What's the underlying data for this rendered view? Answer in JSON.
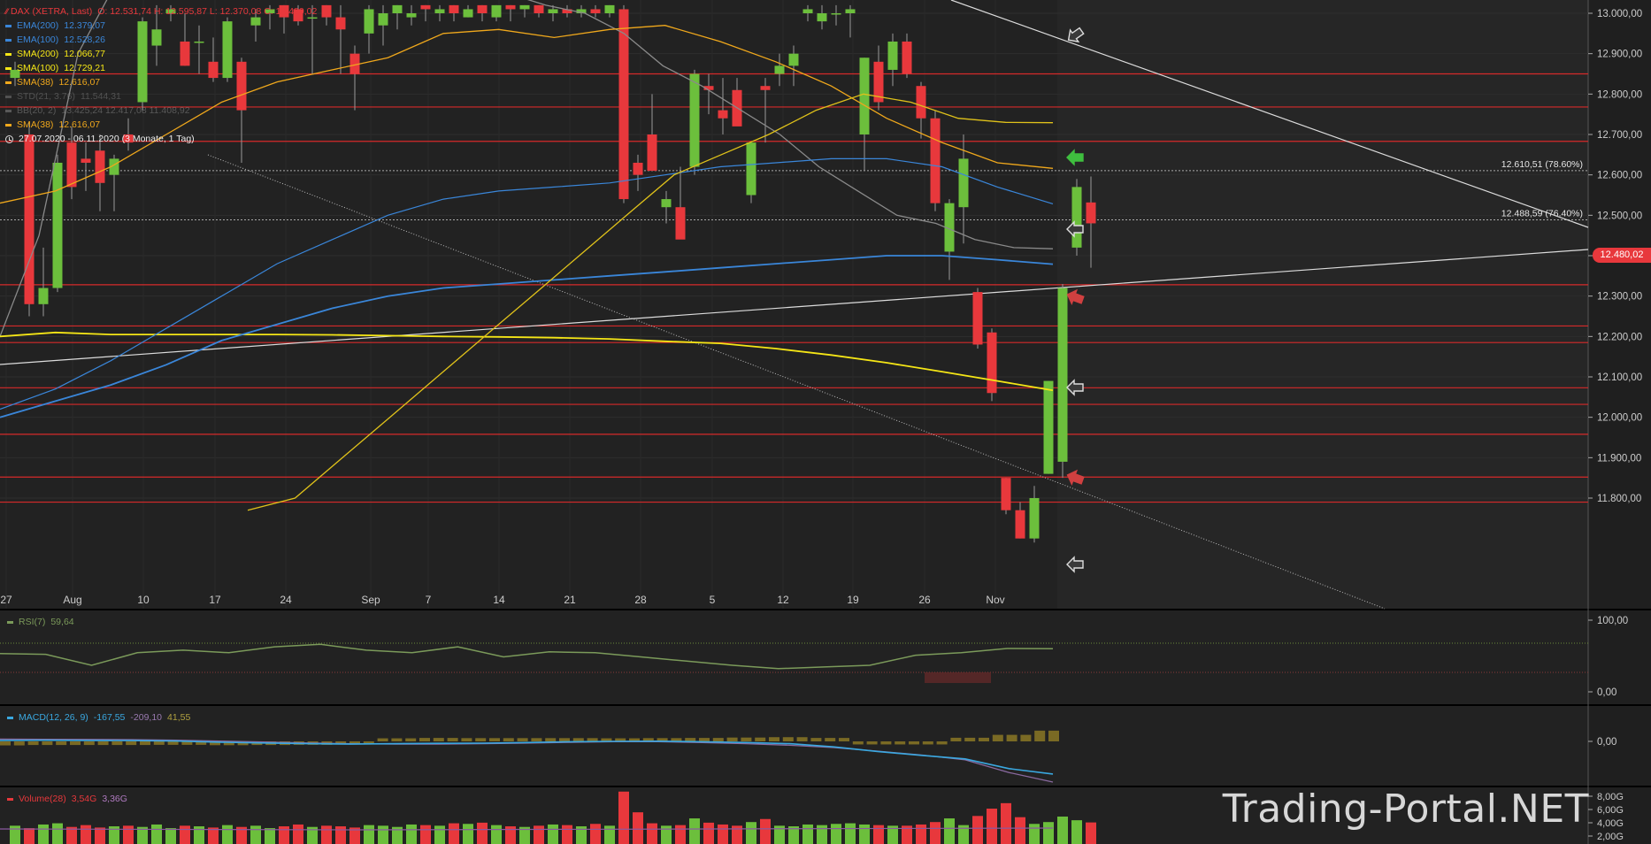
{
  "header": {
    "instrument": "DAX (XETRA, Last)",
    "ohlc": "O: 12.531,74  H: 12.595,87  L: 12.370,08  C: 12.480,02",
    "range": "27.07.2020 - 06.11.2020   (3 Monate, 1 Tag)"
  },
  "indicators": [
    {
      "name": "EMA(200)",
      "value": "12.379,07",
      "color": "#3a86d9",
      "dim": false
    },
    {
      "name": "EMA(100)",
      "value": "12.528,26",
      "color": "#3a86d9",
      "dim": false
    },
    {
      "name": "SMA(200)",
      "value": "12.066,77",
      "color": "#f5e616",
      "dim": false
    },
    {
      "name": "SMA(100)",
      "value": "12.729,21",
      "color": "#f5e616",
      "dim": false
    },
    {
      "name": "SMA(38)",
      "value": "12.616,07",
      "color": "#f0a81c",
      "dim": false
    },
    {
      "name": "STD(21, 3.76)",
      "value": "11.544,31",
      "color": "#888888",
      "dim": true
    },
    {
      "name": "BB(20, 2)",
      "value": "13.425,24  12.417,08  11.408,92",
      "color": "#9a9a9a",
      "dim": true
    },
    {
      "name": "SMA(38)",
      "value": "12.616,07",
      "color": "#f0a81c",
      "dim": false
    }
  ],
  "price_axis": [
    "13.000,00",
    "12.900,00",
    "12.800,00",
    "12.700,00",
    "12.600,00",
    "12.500,00",
    "12.400,00",
    "12.300,00",
    "12.200,00",
    "12.100,00",
    "12.000,00",
    "11.900,00",
    "11.800,00"
  ],
  "date_axis": [
    "27",
    "Aug",
    "10",
    "17",
    "24",
    "Sep",
    "7",
    "14",
    "21",
    "28",
    "5",
    "12",
    "19",
    "26",
    "Nov"
  ],
  "fib_levels": [
    {
      "value": 12610.51,
      "label": "12.610,51 (78.60%)"
    },
    {
      "value": 12488.59,
      "label": "12.488,59 (76.40%)"
    }
  ],
  "last_price": "12.480,02",
  "colors": {
    "up": "#6cbf3c",
    "down": "#e8383c",
    "ema": "#3a86d9",
    "sma_fast": "#f0a81c",
    "sma_mid": "#e0c21a",
    "sma_slow": "#f5e616",
    "bb": "#8a8a8a",
    "hline": "#d62a2a",
    "rsi": "#7b9a5a",
    "macd": "#3aa8e0",
    "signal": "#8a6aa0"
  },
  "rsi": {
    "label": "RSI(7)",
    "value": "59,64",
    "axis": [
      "100,00",
      "0,00"
    ]
  },
  "macd": {
    "label": "MACD(12, 26, 9)",
    "v1": "-167,55",
    "v2": "-209,10",
    "v3": "41,55",
    "axis": [
      "0,00"
    ]
  },
  "volume": {
    "label": "Volume(28)",
    "v1": "3,54G",
    "v2": "3,36G",
    "axis": [
      "8,00G",
      "6,00G",
      "4,00G",
      "2,00G"
    ]
  },
  "watermark": "Trading-Portal.NET",
  "chart_data": {
    "type": "candlestick",
    "ylim": [
      11770,
      13020
    ],
    "candles": [
      {
        "o": 12840,
        "h": 12880,
        "l": 12820,
        "c": 12860
      },
      {
        "o": 12700,
        "h": 12730,
        "l": 12250,
        "c": 12280
      },
      {
        "o": 12280,
        "h": 12420,
        "l": 12250,
        "c": 12320
      },
      {
        "o": 12320,
        "h": 12650,
        "l": 12310,
        "c": 12630
      },
      {
        "o": 12680,
        "h": 12720,
        "l": 12540,
        "c": 12570
      },
      {
        "o": 12640,
        "h": 12680,
        "l": 12560,
        "c": 12630
      },
      {
        "o": 12660,
        "h": 12700,
        "l": 12510,
        "c": 12580
      },
      {
        "o": 12600,
        "h": 12650,
        "l": 12510,
        "c": 12640
      },
      {
        "o": 12700,
        "h": 12740,
        "l": 12660,
        "c": 12680
      },
      {
        "o": 12780,
        "h": 12990,
        "l": 12760,
        "c": 12980
      },
      {
        "o": 12920,
        "h": 13020,
        "l": 12870,
        "c": 12960
      },
      {
        "o": 13000,
        "h": 13020,
        "l": 12980,
        "c": 13010
      },
      {
        "o": 12930,
        "h": 13000,
        "l": 12870,
        "c": 12870
      },
      {
        "o": 12930,
        "h": 12970,
        "l": 12850,
        "c": 12930
      },
      {
        "o": 12880,
        "h": 12940,
        "l": 12830,
        "c": 12840
      },
      {
        "o": 12840,
        "h": 12990,
        "l": 12830,
        "c": 12980
      },
      {
        "o": 12880,
        "h": 12890,
        "l": 12630,
        "c": 12760
      },
      {
        "o": 12970,
        "h": 13010,
        "l": 12930,
        "c": 12990
      },
      {
        "o": 13000,
        "h": 13020,
        "l": 12960,
        "c": 13010
      },
      {
        "o": 13020,
        "h": 13020,
        "l": 12950,
        "c": 12990
      },
      {
        "o": 13010,
        "h": 13020,
        "l": 12970,
        "c": 12980
      },
      {
        "o": 12990,
        "h": 13020,
        "l": 12850,
        "c": 12990
      },
      {
        "o": 13020,
        "h": 13020,
        "l": 12970,
        "c": 12990
      },
      {
        "o": 12990,
        "h": 13020,
        "l": 12850,
        "c": 12960
      },
      {
        "o": 12900,
        "h": 12920,
        "l": 12760,
        "c": 12850
      },
      {
        "o": 12950,
        "h": 13020,
        "l": 12900,
        "c": 13010
      },
      {
        "o": 12970,
        "h": 13020,
        "l": 12920,
        "c": 13000
      },
      {
        "o": 13000,
        "h": 13020,
        "l": 12960,
        "c": 13020
      },
      {
        "o": 12990,
        "h": 13020,
        "l": 12970,
        "c": 13000
      },
      {
        "o": 13020,
        "h": 13020,
        "l": 12980,
        "c": 13010
      },
      {
        "o": 13000,
        "h": 13020,
        "l": 12980,
        "c": 13010
      },
      {
        "o": 13020,
        "h": 13020,
        "l": 12980,
        "c": 13000
      },
      {
        "o": 12990,
        "h": 13020,
        "l": 12990,
        "c": 13010
      },
      {
        "o": 13020,
        "h": 13020,
        "l": 12980,
        "c": 13000
      },
      {
        "o": 12990,
        "h": 13020,
        "l": 12980,
        "c": 13020
      },
      {
        "o": 13020,
        "h": 13020,
        "l": 12980,
        "c": 13010
      },
      {
        "o": 13010,
        "h": 13020,
        "l": 12990,
        "c": 13020
      },
      {
        "o": 13020,
        "h": 13020,
        "l": 12990,
        "c": 13000
      },
      {
        "o": 13000,
        "h": 13020,
        "l": 12980,
        "c": 13010
      },
      {
        "o": 13010,
        "h": 13020,
        "l": 12990,
        "c": 13000
      },
      {
        "o": 13000,
        "h": 13020,
        "l": 12990,
        "c": 13010
      },
      {
        "o": 13010,
        "h": 13020,
        "l": 12990,
        "c": 13000
      },
      {
        "o": 13000,
        "h": 13020,
        "l": 12990,
        "c": 13020
      },
      {
        "o": 13010,
        "h": 13020,
        "l": 12530,
        "c": 12540
      },
      {
        "o": 12630,
        "h": 12650,
        "l": 12560,
        "c": 12600
      },
      {
        "o": 12700,
        "h": 12800,
        "l": 12650,
        "c": 12610
      },
      {
        "o": 12520,
        "h": 12560,
        "l": 12480,
        "c": 12540
      },
      {
        "o": 12520,
        "h": 12620,
        "l": 12460,
        "c": 12440
      },
      {
        "o": 12620,
        "h": 12860,
        "l": 12600,
        "c": 12850
      },
      {
        "o": 12820,
        "h": 12850,
        "l": 12750,
        "c": 12810
      },
      {
        "o": 12760,
        "h": 12840,
        "l": 12700,
        "c": 12740
      },
      {
        "o": 12810,
        "h": 12840,
        "l": 12760,
        "c": 12720
      },
      {
        "o": 12550,
        "h": 12680,
        "l": 12530,
        "c": 12680
      },
      {
        "o": 12820,
        "h": 12840,
        "l": 12680,
        "c": 12810
      },
      {
        "o": 12850,
        "h": 12900,
        "l": 12820,
        "c": 12870
      },
      {
        "o": 12870,
        "h": 12920,
        "l": 12820,
        "c": 12900
      },
      {
        "o": 13000,
        "h": 13020,
        "l": 12980,
        "c": 13010
      },
      {
        "o": 12980,
        "h": 13020,
        "l": 12960,
        "c": 13000
      },
      {
        "o": 13000,
        "h": 13020,
        "l": 12970,
        "c": 13000
      },
      {
        "o": 13000,
        "h": 13020,
        "l": 12940,
        "c": 13010
      },
      {
        "o": 12700,
        "h": 12890,
        "l": 12610,
        "c": 12890
      },
      {
        "o": 12880,
        "h": 12920,
        "l": 12760,
        "c": 12780
      },
      {
        "o": 12860,
        "h": 12950,
        "l": 12820,
        "c": 12930
      },
      {
        "o": 12930,
        "h": 12950,
        "l": 12840,
        "c": 12850
      },
      {
        "o": 12820,
        "h": 12830,
        "l": 12690,
        "c": 12740
      },
      {
        "o": 12740,
        "h": 12760,
        "l": 12510,
        "c": 12530
      },
      {
        "o": 12410,
        "h": 12540,
        "l": 12340,
        "c": 12530
      },
      {
        "o": 12520,
        "h": 12700,
        "l": 12430,
        "c": 12640
      },
      {
        "o": 12310,
        "h": 12320,
        "l": 12170,
        "c": 12180
      },
      {
        "o": 12210,
        "h": 12220,
        "l": 12040,
        "c": 12060
      },
      {
        "o": 11850,
        "h": 11850,
        "l": 11760,
        "c": 11770
      },
      {
        "o": 11770,
        "h": 11790,
        "l": 11700,
        "c": 11700
      },
      {
        "o": 11700,
        "h": 11830,
        "l": 11690,
        "c": 11800
      },
      {
        "o": 11860,
        "h": 12090,
        "l": 11860,
        "c": 12090
      },
      {
        "o": 11890,
        "h": 12330,
        "l": 11850,
        "c": 12320
      },
      {
        "o": 12420,
        "h": 12590,
        "l": 12400,
        "c": 12570
      },
      {
        "o": 12531.74,
        "h": 12595.87,
        "l": 12370.08,
        "c": 12480.02
      }
    ],
    "hlines": [
      12850,
      12768,
      12683,
      12328,
      12226,
      12185,
      12073,
      12032,
      11958,
      11852,
      11790
    ],
    "sma200": [
      12200,
      12210,
      12205,
      12205,
      12205,
      12205,
      12204,
      12202,
      12200,
      12199,
      12197,
      12194,
      12188,
      12183,
      12170,
      12154,
      12135,
      12113,
      12090,
      12066.77
    ],
    "ema200": [
      12000,
      12040,
      12080,
      12130,
      12190,
      12230,
      12270,
      12300,
      12320,
      12330,
      12340,
      12350,
      12360,
      12370,
      12380,
      12390,
      12400,
      12400,
      12390,
      12379.07
    ],
    "ema100": [
      12020,
      12070,
      12140,
      12220,
      12300,
      12380,
      12440,
      12500,
      12540,
      12560,
      12570,
      12580,
      12600,
      12620,
      12630,
      12640,
      12640,
      12620,
      12570,
      12528.26
    ],
    "sma38": [
      12530,
      12560,
      12620,
      12700,
      12780,
      12830,
      12860,
      12890,
      12950,
      12960,
      12940,
      12960,
      12970,
      12930,
      12880,
      12820,
      12740,
      12680,
      12630,
      12616.07
    ],
    "sma100": [
      11770,
      11800,
      11900,
      12000,
      12100,
      12200,
      12300,
      12400,
      12500,
      12600,
      12650,
      12700,
      12760,
      12800,
      12780,
      12740,
      12730,
      12729.21
    ],
    "bbUpper": [
      12200,
      12450,
      12900,
      13080,
      13200,
      13250,
      13300,
      13350,
      13260,
      13200,
      13150,
      13100,
      13080,
      13050,
      13020,
      13000,
      12950,
      12870,
      12820,
      12760,
      12700,
      12620,
      12560,
      12500,
      12480,
      12440,
      12420,
      12417.08
    ],
    "rsi": [
      54,
      53,
      40,
      55,
      58,
      55,
      62,
      65,
      58,
      55,
      62,
      50,
      56,
      55,
      50,
      45,
      40,
      36,
      38,
      40,
      52,
      55,
      60,
      59.64
    ],
    "macd": [
      5,
      6,
      5,
      4,
      2,
      -4,
      -8,
      -12,
      -14,
      -12,
      -10,
      -9,
      -6,
      -2,
      0,
      1,
      -2,
      -6,
      -12,
      -28,
      -52,
      -72,
      -90,
      -140,
      -167.55
    ],
    "signal": [
      12,
      11,
      10,
      9,
      6,
      2,
      -3,
      -8,
      -12,
      -14,
      -14,
      -12,
      -9,
      -5,
      -2,
      -2,
      -6,
      -12,
      -20,
      -32,
      -50,
      -70,
      -95,
      -160,
      -209.1
    ],
    "volume": [
      3.0,
      2.6,
      3.2,
      3.4,
      2.8,
      3.1,
      2.7,
      2.9,
      3.0,
      2.8,
      3.2,
      2.6,
      3.0,
      2.9,
      2.7,
      3.1,
      2.8,
      3.0,
      2.6,
      2.9,
      3.2,
      2.8,
      3.0,
      2.9,
      2.7,
      3.1,
      3.0,
      2.8,
      3.2,
      3.1,
      3.0,
      3.4,
      3.3,
      3.5,
      3.1,
      2.9,
      2.8,
      3.0,
      3.2,
      3.1,
      2.9,
      3.3,
      3.0,
      8.6,
      5.2,
      3.4,
      3.0,
      3.1,
      4.2,
      3.5,
      3.2,
      3.0,
      3.6,
      4.1,
      3.0,
      2.9,
      3.2,
      3.1,
      3.3,
      3.4,
      3.2,
      3.1,
      3.0,
      3.0,
      3.2,
      3.6,
      4.2,
      3.1,
      4.6,
      5.8,
      6.7,
      4.4,
      3.3,
      3.6,
      4.5,
      3.9,
      3.54
    ]
  }
}
